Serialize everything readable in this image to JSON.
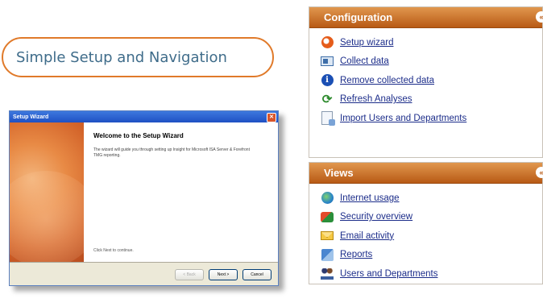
{
  "heading": "Simple Setup and Navigation",
  "wizard": {
    "title": "Setup Wizard",
    "heading": "Welcome to the Setup Wizard",
    "body_text": "The wizard will guide you through setting up Insight for Microsoft ISA Server & Forefront TMG reporting.",
    "next_hint": "Click Next to continue.",
    "buttons": {
      "back": "< Back",
      "next": "Next >",
      "cancel": "Cancel"
    }
  },
  "configuration": {
    "title": "Configuration",
    "collapse_glyph": "«",
    "items": [
      {
        "label": "Setup wizard",
        "icon": "wizard-icon"
      },
      {
        "label": "Collect data",
        "icon": "collect-data-icon"
      },
      {
        "label": "Remove collected data",
        "icon": "info-icon"
      },
      {
        "label": "Refresh Analyses",
        "icon": "refresh-icon"
      },
      {
        "label": "Import Users and Departments",
        "icon": "import-icon"
      }
    ]
  },
  "views": {
    "title": "Views",
    "collapse_glyph": "«",
    "items": [
      {
        "label": "Internet usage",
        "icon": "globe-icon"
      },
      {
        "label": "Security overview",
        "icon": "shield-icon"
      },
      {
        "label": "Email activity",
        "icon": "mail-icon"
      },
      {
        "label": "Reports",
        "icon": "reports-icon"
      },
      {
        "label": "Users and Departments",
        "icon": "users-icon"
      }
    ]
  },
  "colors": {
    "accent": "#e07a2a",
    "heading_text": "#3f6c8a",
    "link": "#1c2d8a",
    "panel_header": "#c8661c"
  }
}
